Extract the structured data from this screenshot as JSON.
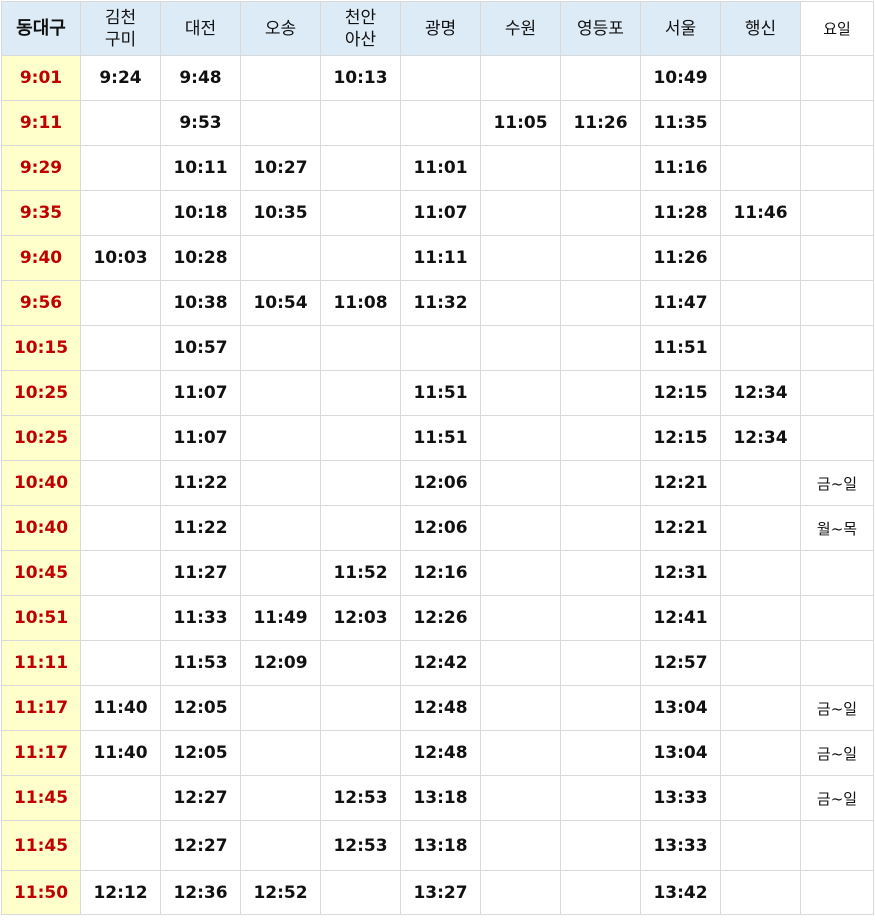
{
  "table": {
    "headers": [
      "동대구",
      "김천\n구미",
      "대전",
      "오송",
      "천안\n아산",
      "광명",
      "수원",
      "영등포",
      "서울",
      "행신",
      "요일"
    ],
    "rows": [
      [
        "9:01",
        "9:24",
        "9:48",
        "",
        "10:13",
        "",
        "",
        "",
        "10:49",
        "",
        ""
      ],
      [
        "9:11",
        "",
        "9:53",
        "",
        "",
        "",
        "11:05",
        "11:26",
        "11:35",
        "",
        ""
      ],
      [
        "9:29",
        "",
        "10:11",
        "10:27",
        "",
        "11:01",
        "",
        "",
        "11:16",
        "",
        ""
      ],
      [
        "9:35",
        "",
        "10:18",
        "10:35",
        "",
        "11:07",
        "",
        "",
        "11:28",
        "11:46",
        ""
      ],
      [
        "9:40",
        "10:03",
        "10:28",
        "",
        "",
        "11:11",
        "",
        "",
        "11:26",
        "",
        ""
      ],
      [
        "9:56",
        "",
        "10:38",
        "10:54",
        "11:08",
        "11:32",
        "",
        "",
        "11:47",
        "",
        ""
      ],
      [
        "10:15",
        "",
        "10:57",
        "",
        "",
        "",
        "",
        "",
        "11:51",
        "",
        ""
      ],
      [
        "10:25",
        "",
        "11:07",
        "",
        "",
        "11:51",
        "",
        "",
        "12:15",
        "12:34",
        ""
      ],
      [
        "10:25",
        "",
        "11:07",
        "",
        "",
        "11:51",
        "",
        "",
        "12:15",
        "12:34",
        ""
      ],
      [
        "10:40",
        "",
        "11:22",
        "",
        "",
        "12:06",
        "",
        "",
        "12:21",
        "",
        "금~일"
      ],
      [
        "10:40",
        "",
        "11:22",
        "",
        "",
        "12:06",
        "",
        "",
        "12:21",
        "",
        "월~목"
      ],
      [
        "10:45",
        "",
        "11:27",
        "",
        "11:52",
        "12:16",
        "",
        "",
        "12:31",
        "",
        ""
      ],
      [
        "10:51",
        "",
        "11:33",
        "11:49",
        "12:03",
        "12:26",
        "",
        "",
        "12:41",
        "",
        ""
      ],
      [
        "11:11",
        "",
        "11:53",
        "12:09",
        "",
        "12:42",
        "",
        "",
        "12:57",
        "",
        ""
      ],
      [
        "11:17",
        "11:40",
        "12:05",
        "",
        "",
        "12:48",
        "",
        "",
        "13:04",
        "",
        "금~일"
      ],
      [
        "11:17",
        "11:40",
        "12:05",
        "",
        "",
        "12:48",
        "",
        "",
        "13:04",
        "",
        "금~일"
      ],
      [
        "11:45",
        "",
        "12:27",
        "",
        "12:53",
        "13:18",
        "",
        "",
        "13:33",
        "",
        "금~일"
      ],
      [
        "11:45",
        "",
        "12:27",
        "",
        "12:53",
        "13:18",
        "",
        "",
        "13:33",
        "",
        ""
      ],
      [
        "11:50",
        "12:12",
        "12:36",
        "12:52",
        "",
        "13:27",
        "",
        "",
        "13:42",
        "",
        ""
      ]
    ]
  },
  "colors": {
    "header_bg": "#ddebf7",
    "origin_bg": "#ffffcc",
    "origin_text": "#c00000",
    "grid_line": "#d9d9d9"
  }
}
